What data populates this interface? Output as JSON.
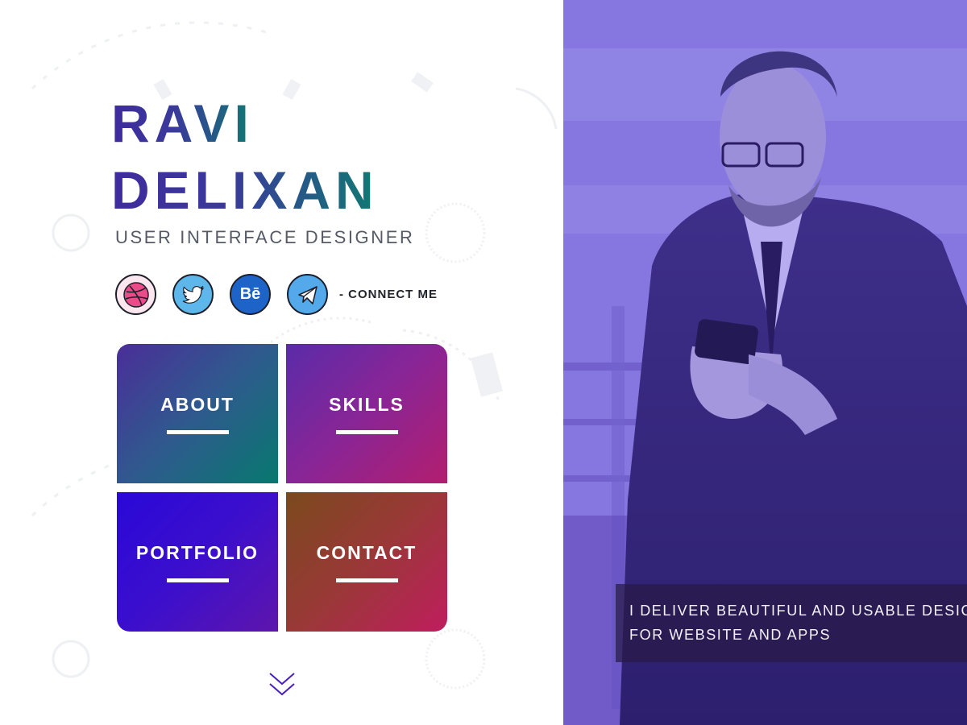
{
  "profile": {
    "first_name": "RAVI",
    "last_name": "DELIXAN",
    "role": "USER INTERFACE DESIGNER"
  },
  "social": {
    "items": [
      {
        "name": "dribbble",
        "icon": "dribbble-icon"
      },
      {
        "name": "twitter",
        "icon": "twitter-icon"
      },
      {
        "name": "behance",
        "icon": "behance-icon",
        "glyph": "Bē"
      },
      {
        "name": "telegram",
        "icon": "telegram-icon"
      }
    ],
    "connect_label": "- CONNECT ME"
  },
  "tiles": [
    {
      "id": "about",
      "label": "ABOUT"
    },
    {
      "id": "skills",
      "label": "SKILLS"
    },
    {
      "id": "portfolio",
      "label": "PORTFOLIO"
    },
    {
      "id": "contact",
      "label": "CONTACT"
    }
  ],
  "hero": {
    "caption_line1": "I DELIVER BEAUTIFUL AND USABLE DESIGN",
    "caption_line2": "FOR WEBSITE AND APPS"
  },
  "colors": {
    "accent_purple": "#3f2b9e",
    "accent_teal": "#0f7a72",
    "hero_overlay": "#7b6bd9"
  }
}
